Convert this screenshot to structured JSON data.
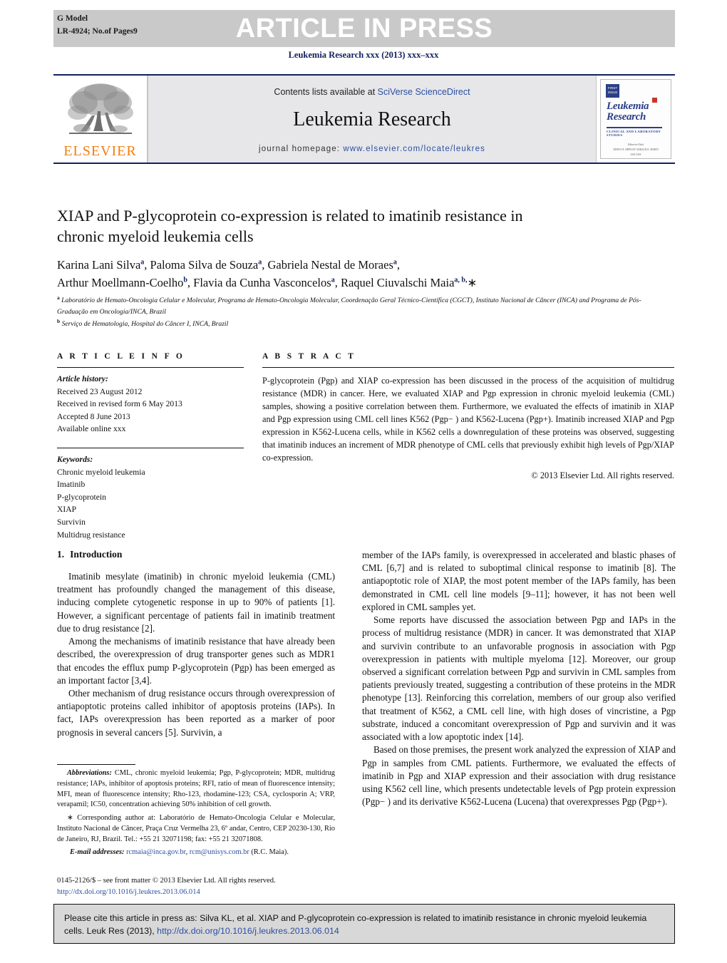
{
  "banner": {
    "g_model": "G Model",
    "article_id": "LR-4924;   No.of Pages9",
    "article_in_press": "ARTICLE IN PRESS"
  },
  "journal_ref": "Leukemia Research xxx (2013) xxx–xxx",
  "masthead": {
    "publisher_name": "ELSEVIER",
    "contents_prefix": "Contents lists available at ",
    "contents_link": "SciVerse ScienceDirect",
    "journal_title": "Leukemia Research",
    "homepage_prefix": "journal homepage: ",
    "homepage_url": "www.elsevier.com/locate/leukres",
    "cover": {
      "badge": "FIRST ISSUE",
      "title_line1": "Leukemia",
      "title_line2": "Research",
      "subtitle": "CLINICAL AND LABORATORY STUDIES",
      "meta1": "Editor-in-Chief",
      "meta2": "JOHN F.X. DIFFLEY          GERALD E. MARTI",
      "meta3": "USA                                 USA"
    }
  },
  "article": {
    "title": "XIAP and P-glycoprotein co-expression is related to imatinib resistance in chronic myeloid leukemia cells",
    "authors_line1": "Karina Lani Silva",
    "authors_line1_b": ", Paloma Silva de Souza",
    "authors_line1_c": ", Gabriela Nestal de Moraes",
    "authors_line2": "Arthur Moellmann-Coelho",
    "authors_line2_b": ", Flavia da Cunha Vasconcelos",
    "authors_line2_c": ", Raquel Ciuvalschi Maia",
    "affiliation_a": "Laboratório de Hemato-Oncologia Celular e Molecular, Programa de Hemato-Oncologia Molecular, Coordenação Geral Técnico-Científica (CGCT), Instituto Nacional de Câncer (INCA) and Programa de Pós-Graduação em Oncologia/INCA, Brazil",
    "affiliation_b": "Serviço de Hematologia, Hospital do Câncer I, INCA, Brazil"
  },
  "article_info": {
    "heading": "A R T I C L E    I N F O",
    "history_label": "Article history:",
    "history": [
      "Received 23 August 2012",
      "Received in revised form 6 May 2013",
      "Accepted 8 June 2013",
      "Available online xxx"
    ],
    "keywords_label": "Keywords:",
    "keywords": [
      "Chronic myeloid leukemia",
      "Imatinib",
      "P-glycoprotein",
      "XIAP",
      "Survivin",
      "Multidrug resistance"
    ]
  },
  "abstract": {
    "heading": "A B S T R A C T",
    "text": "P-glycoprotein (Pgp) and XIAP co-expression has been discussed in the process of the acquisition of multidrug resistance (MDR) in cancer. Here, we evaluated XIAP and Pgp expression in chronic myeloid leukemia (CML) samples, showing a positive correlation between them. Furthermore, we evaluated the effects of imatinib in XIAP and Pgp expression using CML cell lines K562 (Pgp− ) and K562-Lucena (Pgp+). Imatinib increased XIAP and Pgp expression in K562-Lucena cells, while in K562 cells a downregulation of these proteins was observed, suggesting that imatinib induces an increment of MDR phenotype of CML cells that previously exhibit high levels of Pgp/XIAP co-expression.",
    "copyright": "© 2013 Elsevier Ltd. All rights reserved."
  },
  "body": {
    "section_number": "1.",
    "section_title": "Introduction",
    "left_paragraphs": [
      "Imatinib mesylate (imatinib) in chronic myeloid leukemia (CML) treatment has profoundly changed the management of this disease, inducing complete cytogenetic response in up to 90% of patients [1]. However, a significant percentage of patients fail in imatinib treatment due to drug resistance [2].",
      "Among the mechanisms of imatinib resistance that have already been described, the overexpression of drug transporter genes such as MDR1 that encodes the efflux pump P-glycoprotein (Pgp) has been emerged as an important factor [3,4].",
      "Other mechanism of drug resistance occurs through overexpression of antiapoptotic proteins called inhibitor of apoptosis proteins (IAPs). In fact, IAPs overexpression has been reported as a marker of poor prognosis in several cancers [5]. Survivin, a"
    ],
    "right_paragraphs": [
      "member of the IAPs family, is overexpressed in accelerated and blastic phases of CML [6,7] and is related to suboptimal clinical response to imatinib [8]. The antiapoptotic role of XIAP, the most potent member of the IAPs family, has been demonstrated in CML cell line models [9–11]; however, it has not been well explored in CML samples yet.",
      "Some reports have discussed the association between Pgp and IAPs in the process of multidrug resistance (MDR) in cancer. It was demonstrated that XIAP and survivin contribute to an unfavorable prognosis in association with Pgp overexpression in patients with multiple myeloma [12]. Moreover, our group observed a significant correlation between Pgp and survivin in CML samples from patients previously treated, suggesting a contribution of these proteins in the MDR phenotype [13]. Reinforcing this correlation, members of our group also verified that treatment of K562, a CML cell line, with high doses of vincristine, a Pgp substrate, induced a concomitant overexpression of Pgp and survivin and it was associated with a low apoptotic index [14].",
      "Based on those premises, the present work analyzed the expression of XIAP and Pgp in samples from CML patients. Furthermore, we evaluated the effects of imatinib in Pgp and XIAP expression and their association with drug resistance using K562 cell line, which presents undetectable levels of Pgp protein expression (Pgp− ) and its derivative K562-Lucena (Lucena) that overexpresses Pgp (Pgp+)."
    ]
  },
  "footnotes": {
    "abbreviations_label": "Abbreviations:",
    "abbreviations_text": " CML, chronic myeloid leukemia; Pgp, P-glycoprotein; MDR, multidrug resistance; IAPs, inhibitor of apoptosis proteins; RFI, ratio of mean of fluorescence intensity; MFI, mean of fluorescence intensity; Rho-123, rhodamine-123; CSA, cyclosporin A; VRP, verapamil; IC50, concentration achieving 50% inhibition of cell growth.",
    "corresponding_text": "Corresponding author at: Laboratório de Hemato-Oncologia Celular e Molecular, Instituto Nacional de Câncer, Praça Cruz Vermelha 23, 6º andar, Centro, CEP 20230-130, Rio de Janeiro, RJ, Brazil. Tel.: +55 21 32071198; fax: +55 21 32071808.",
    "email_label": "E-mail addresses:",
    "email_1": "rcmaia@inca.gov.br",
    "email_2": "rcm@unisys.com.br",
    "email_suffix": " (R.C. Maia).",
    "imprint_line": "0145-2126/$ – see front matter © 2013 Elsevier Ltd. All rights reserved.",
    "imprint_doi": "http://dx.doi.org/10.1016/j.leukres.2013.06.014"
  },
  "cite_box": {
    "text": "Please cite this article in press as: Silva KL, et al. XIAP and P-glycoprotein co-expression is related to imatinib resistance in chronic myeloid leukemia cells. Leuk Res (2013), ",
    "doi": "http://dx.doi.org/10.1016/j.leukres.2013.06.014"
  }
}
